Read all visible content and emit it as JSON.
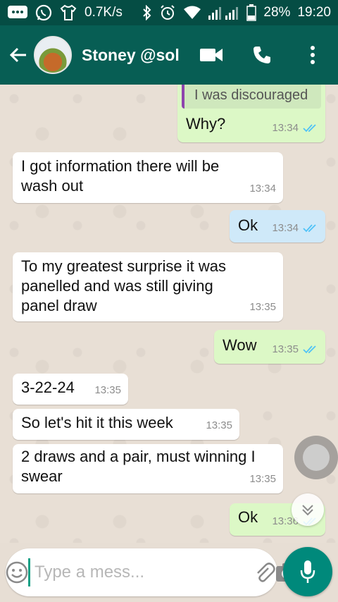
{
  "status_bar": {
    "speed": "0.7K/s",
    "battery": "28%",
    "time": "19:20",
    "icons": [
      "message-icon",
      "whatsapp-icon",
      "shirt-icon",
      "bluetooth-icon",
      "alarm-icon",
      "wifi-icon",
      "signal-icon",
      "battery-icon"
    ]
  },
  "header": {
    "contact_name": "Stoney @sol",
    "icons": [
      "back-arrow-icon",
      "video-call-icon",
      "phone-icon",
      "more-vert-icon"
    ]
  },
  "messages": [
    {
      "id": "m0",
      "side": "out",
      "quoted": "I was discouraged",
      "text": "Why?",
      "time": "13:34",
      "ticks": "read"
    },
    {
      "id": "m1",
      "side": "in",
      "text": "I got information there will be wash out",
      "time": "13:34"
    },
    {
      "id": "m2",
      "side": "out",
      "text": "Ok",
      "time": "13:34",
      "ticks": "read",
      "selected": true
    },
    {
      "id": "m3",
      "side": "in",
      "text": "To my greatest surprise it was panelled and was still giving panel draw",
      "time": "13:35"
    },
    {
      "id": "m4",
      "side": "out",
      "text": "Wow",
      "time": "13:35",
      "ticks": "read"
    },
    {
      "id": "m5",
      "side": "in",
      "text": "3-22-24",
      "time": "13:35"
    },
    {
      "id": "m6",
      "side": "in",
      "text": "So let's hit it this week",
      "time": "13:35"
    },
    {
      "id": "m7",
      "side": "in",
      "text": "2 draws and a pair, must winning I swear",
      "time": "13:35"
    },
    {
      "id": "m8",
      "side": "out",
      "text": "Ok",
      "time": "13:36",
      "ticks": "read"
    }
  ],
  "composer": {
    "placeholder": "Type a mess...",
    "icons": [
      "emoji-icon",
      "attach-icon",
      "camera-icon",
      "mic-icon"
    ]
  },
  "colors": {
    "status_bar": "#054d44",
    "app_bar": "#075e54",
    "outgoing_bubble": "#dcf8c6",
    "incoming_bubble": "#ffffff",
    "selected_bubble": "#cfe9f9",
    "read_ticks": "#4fc3f7",
    "mic_button": "#00897b"
  }
}
